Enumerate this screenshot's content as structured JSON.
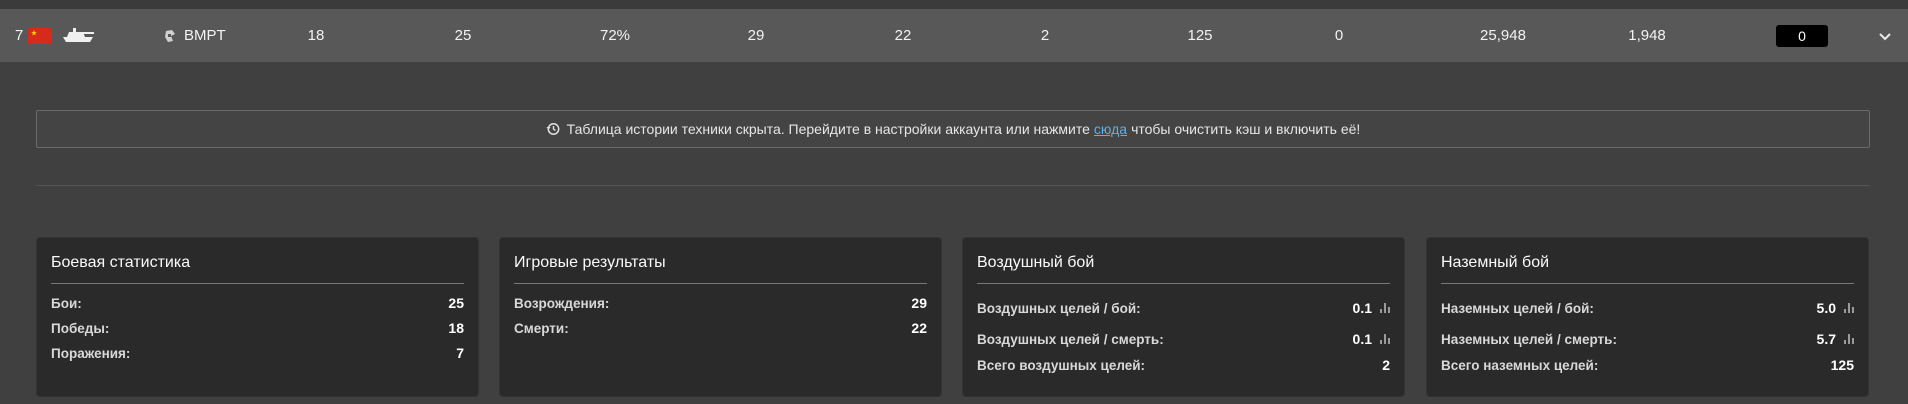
{
  "vehicle_row": {
    "rank": "7",
    "name": "BMPT",
    "battles": "18",
    "col2": "25",
    "winrate": "72%",
    "col4": "29",
    "col5": "22",
    "col6": "2",
    "col7": "125",
    "col8": "0",
    "col9": "25,948",
    "col10": "1,948",
    "score": "0"
  },
  "notice": {
    "text_before": "Таблица истории техники скрыта. Перейдите в настройки аккаунта или нажмите",
    "link": "сюда",
    "text_after": "чтобы очистить кэш и включить её!"
  },
  "cards": {
    "combat": {
      "title": "Боевая статистика",
      "rows": [
        {
          "label": "Бои:",
          "value": "25"
        },
        {
          "label": "Победы:",
          "value": "18"
        },
        {
          "label": "Поражения:",
          "value": "7"
        }
      ]
    },
    "game": {
      "title": "Игровые результаты",
      "rows": [
        {
          "label": "Возрождения:",
          "value": "29"
        },
        {
          "label": "Смерти:",
          "value": "22"
        }
      ]
    },
    "air": {
      "title": "Воздушный бой",
      "rows": [
        {
          "label": "Воздушных целей / бой:",
          "value": "0.1"
        },
        {
          "label": "Воздушных целей / смерть:",
          "value": "0.1"
        },
        {
          "label": "Всего воздушных целей:",
          "value": "2"
        }
      ]
    },
    "ground": {
      "title": "Наземный бой",
      "rows": [
        {
          "label": "Наземных целей / бой:",
          "value": "5.0"
        },
        {
          "label": "Наземных целей / смерть:",
          "value": "5.7"
        },
        {
          "label": "Всего наземных целей:",
          "value": "125"
        }
      ]
    }
  }
}
